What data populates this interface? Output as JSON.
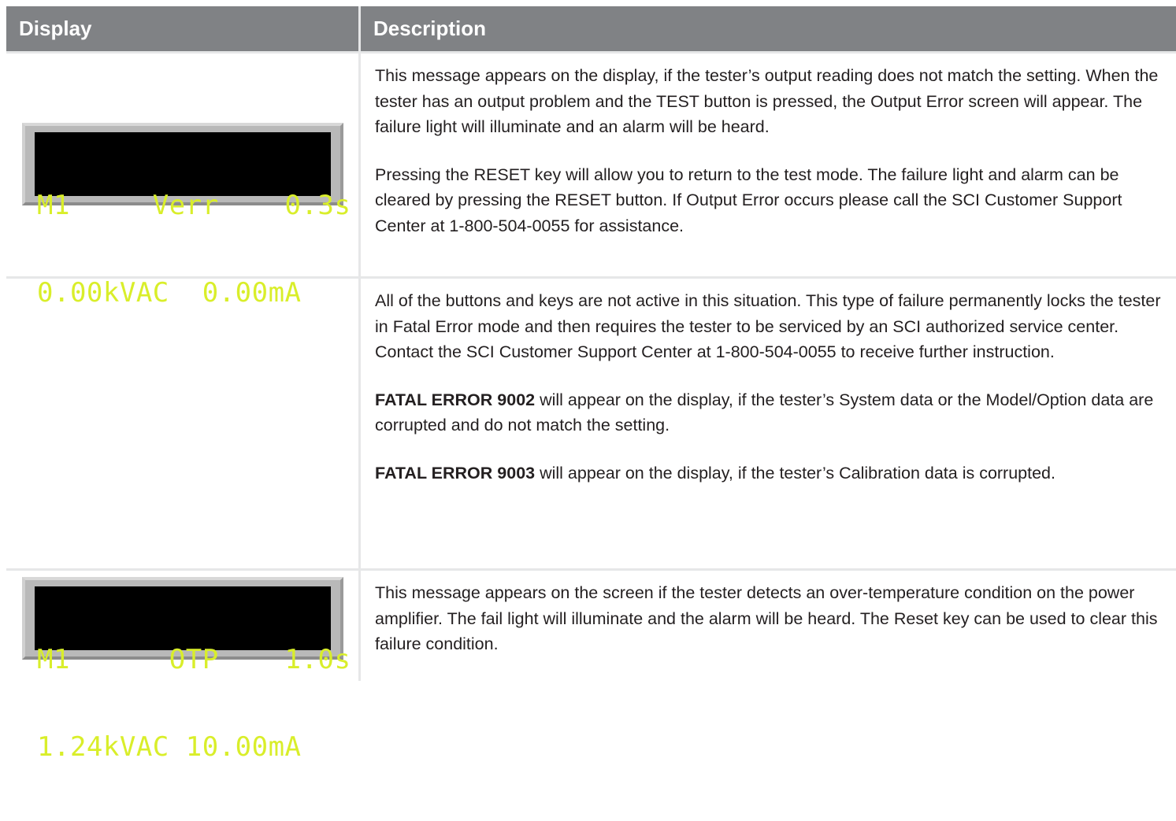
{
  "table": {
    "headers": {
      "display": "Display",
      "description": "Description"
    },
    "rows": [
      {
        "lcd": {
          "line1": "M1     Verr    0.3s",
          "line2": "0.00kVAC  0.00mA"
        },
        "paragraphs": [
          "This message appears on the display, if the tester’s output reading does not match the setting. When the tester has an output problem and the TEST button is pressed, the Output Error screen will appear. The failure light will illuminate and  an alarm will be heard.",
          "Pressing the RESET key will allow you to return to the test mode. The failure light and alarm can be cleared by pressing the RESET button. If Output Error occurs please call the SCI Customer Support Center at 1-800-504-0055 for assistance."
        ]
      },
      {
        "intro": "All of the buttons and keys are not active in this situation. This type of failure permanently locks the tester in Fatal Error mode and then requires the tester to be serviced by an SCI authorized service center. Contact the SCI Customer Support Center at 1-800-504-0055 to receive further instruction.",
        "error1_code": "FATAL ERROR 9002",
        "error1_text": " will appear on the display, if the tester’s System data or the Model/Option data are corrupted and do not match the setting.",
        "error2_code": "FATAL ERROR 9003",
        "error2_text": " will appear on the display, if the tester’s Calibration data is corrupted."
      },
      {
        "lcd": {
          "line1": "M1      OTP    1.0s",
          "line2": "1.24kVAC 10.00mA"
        },
        "paragraphs": [
          "This message appears on the screen if the tester detects an over-temperature condition on the power amplifier. The fail light will illuminate and the alarm will be heard. The Reset key can be used to clear this failure condition."
        ]
      }
    ]
  }
}
